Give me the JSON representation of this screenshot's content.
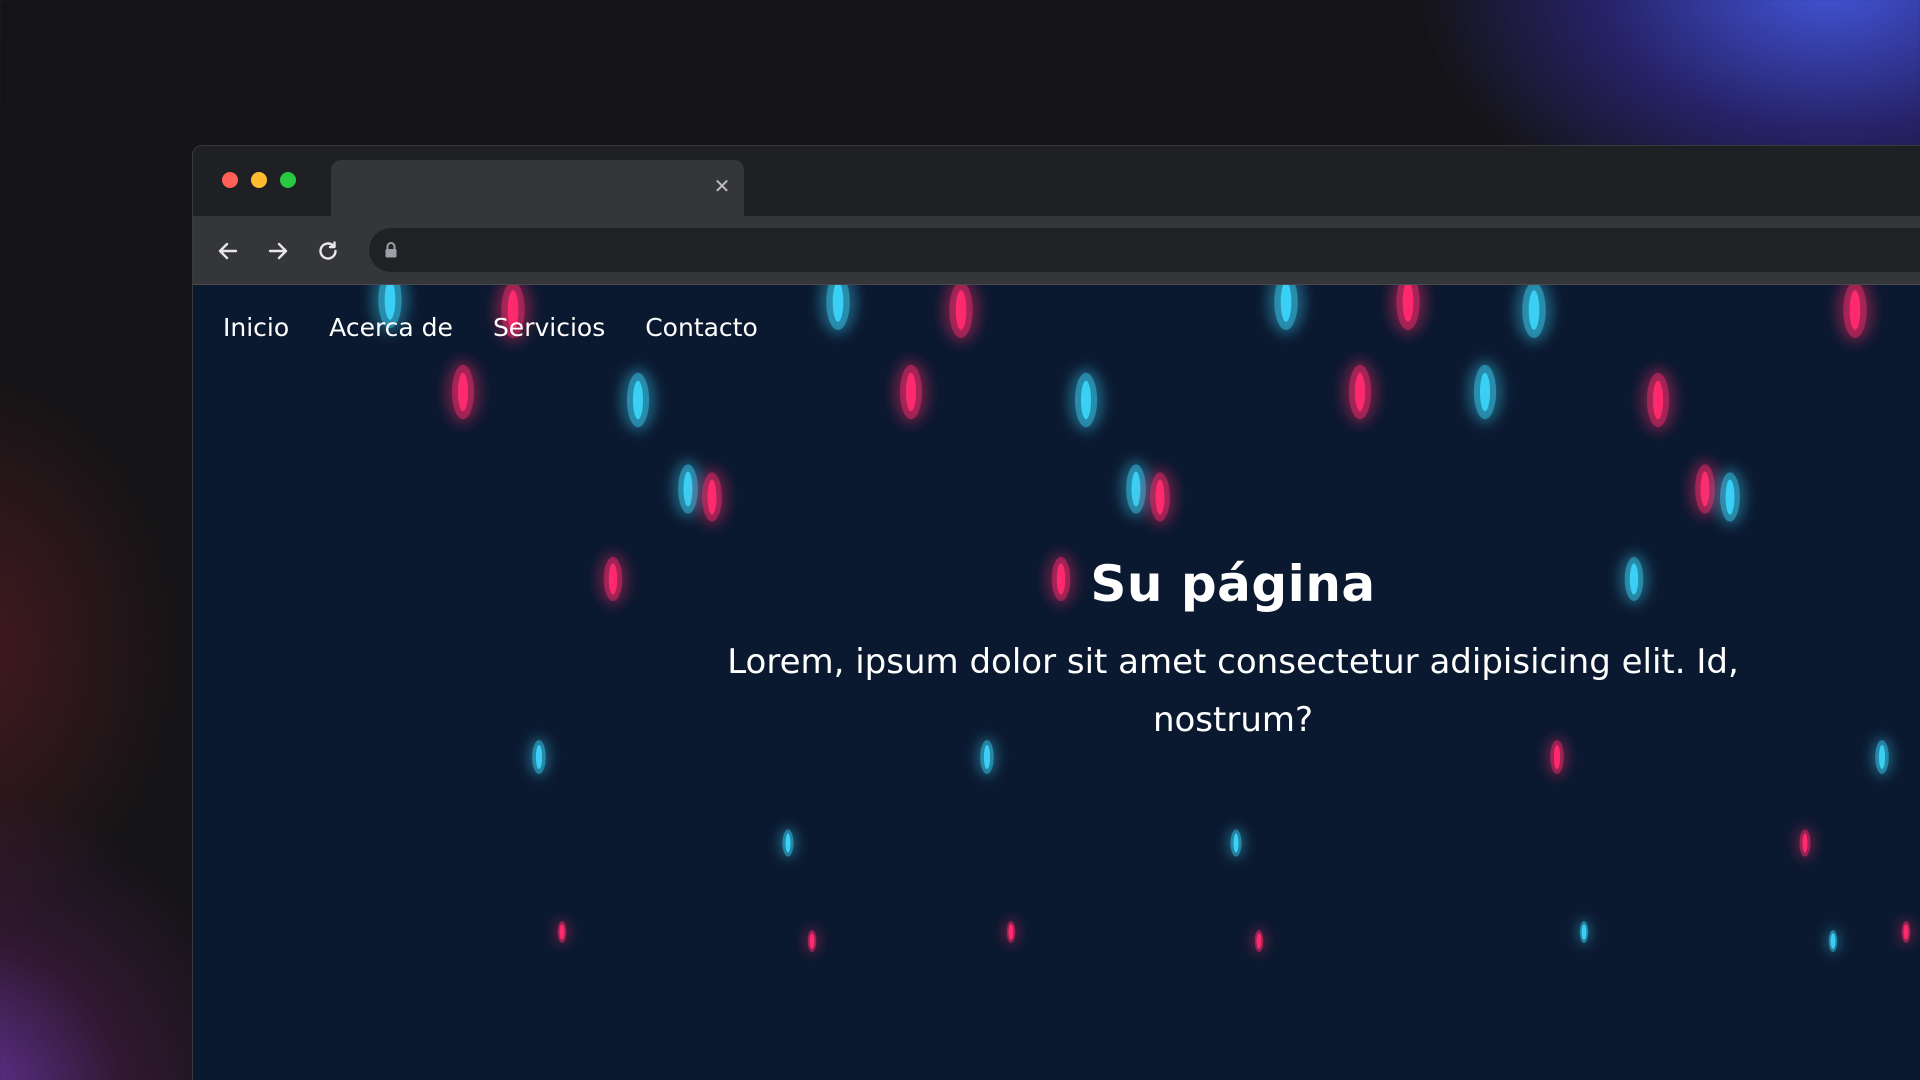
{
  "browser": {
    "tab": {
      "close_icon": "close-icon"
    },
    "colors": {
      "close": "#ff5f57",
      "minimize": "#febc2e",
      "maximize": "#28c840"
    }
  },
  "site": {
    "nav": [
      {
        "label": "Inicio"
      },
      {
        "label": "Acerca de"
      },
      {
        "label": "Servicios"
      },
      {
        "label": "Contacto"
      }
    ],
    "hero": {
      "title": "Su página",
      "text": "Lorem, ipsum dolor sit amet consectetur adipisicing elit. Id, nostrum?"
    },
    "colors": {
      "background": "#0b1930",
      "drop_pink": "#ff2a6d",
      "drop_cyan": "#3ad0f5"
    }
  }
}
